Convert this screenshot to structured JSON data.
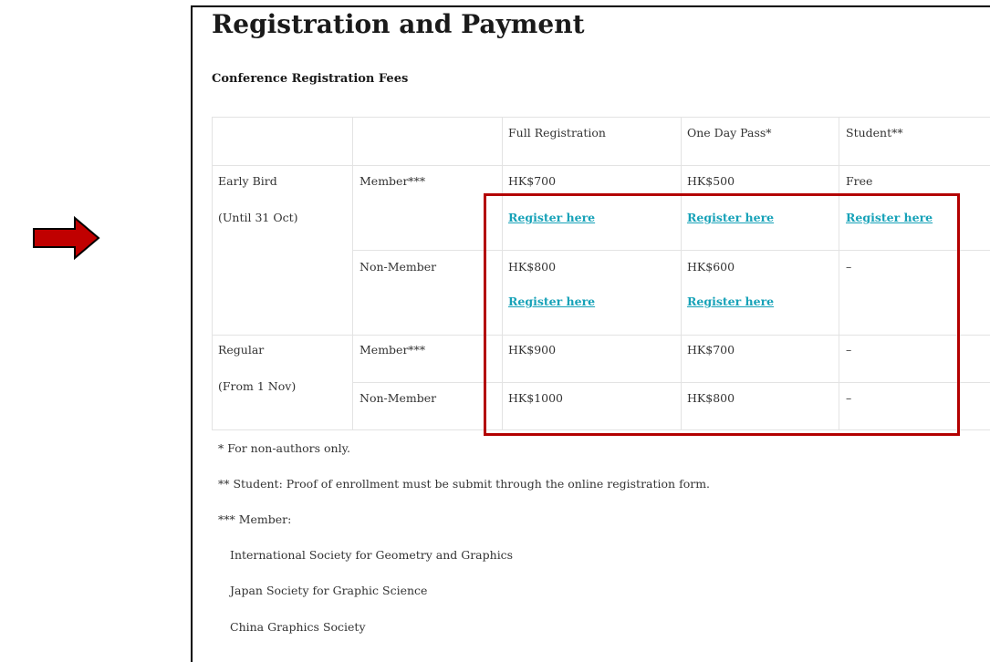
{
  "page": {
    "title": "Registration and Payment",
    "subtitle": "Conference Registration Fees"
  },
  "table": {
    "headers": [
      "",
      "",
      "Full Registration",
      "One Day Pass*",
      "Student**"
    ],
    "early_bird": {
      "label": "Early Bird",
      "period": "(Until 31 Oct)",
      "member": {
        "label": "Member***",
        "full": "HK$700",
        "day": "HK$500",
        "student": "Free"
      },
      "non_member": {
        "label": "Non-Member",
        "full": "HK$800",
        "day": "HK$600",
        "student": "–"
      }
    },
    "regular": {
      "label": "Regular",
      "period": "(From 1 Nov)",
      "member": {
        "label": "Member***",
        "full": "HK$900",
        "day": "HK$700",
        "student": "–"
      },
      "non_member": {
        "label": "Non-Member",
        "full": "HK$1000",
        "day": "HK$800",
        "student": "–"
      }
    },
    "register_label": "Register here"
  },
  "notes": {
    "non_authors": "* For non-authors only.",
    "student": "** Student: Proof of enrollment must be submit through the online registration form.",
    "member": "*** Member:",
    "societies": [
      "International Society for Geometry and Graphics",
      "Japan Society for Graphic Science",
      "China Graphics Society"
    ]
  },
  "colors": {
    "link": "#17a2b8",
    "highlight_box": "#b30000",
    "arrow": "#c00000"
  }
}
